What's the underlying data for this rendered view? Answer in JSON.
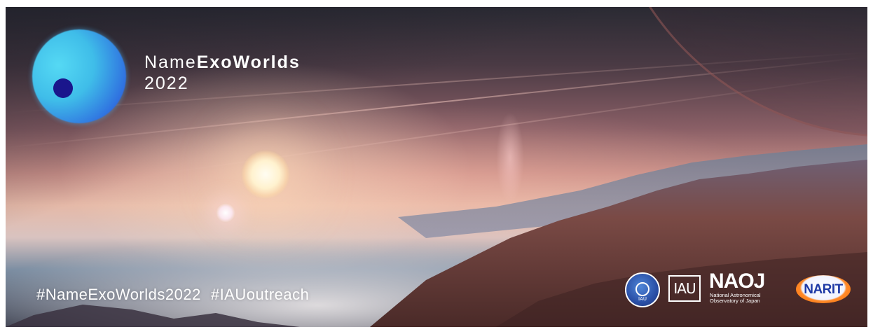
{
  "banner": {
    "title_light": "Name",
    "title_bold": "ExoWorlds",
    "year": "2022",
    "hashtags": [
      "#NameExoWorlds2022",
      "#IAUoutreach"
    ]
  },
  "partner_logos": {
    "iau_circle_text": "IAU",
    "iau_box_text": "IAU",
    "naoj_big": "NAOJ",
    "naoj_sub1": "National Astronomical",
    "naoj_sub2": "Observatory of Japan",
    "narit": "NARIT"
  },
  "colors": {
    "logo_circle": "#3fbde9",
    "logo_dot": "#1a168c",
    "text": "#ffffff",
    "narit_ring": "#ff6d00",
    "narit_text": "#1f3aa6"
  }
}
